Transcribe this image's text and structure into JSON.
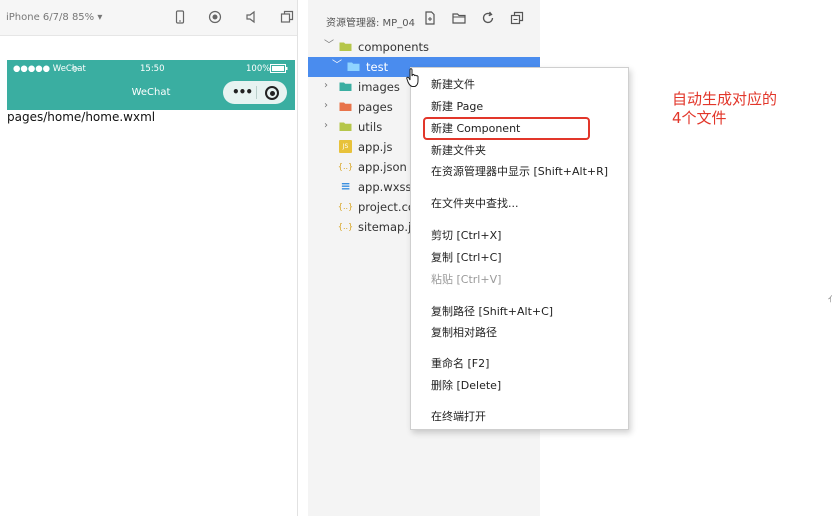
{
  "simulator": {
    "device_label": "iPhone 6/7/8 85% ▾",
    "status": {
      "carrier": "●●●●● WeChat",
      "time": "15:50",
      "battery": "100%"
    },
    "nav_title": "WeChat",
    "page_path": "pages/home/home.wxml"
  },
  "explorer": {
    "title": "资源管理器: MP_04",
    "tree": [
      {
        "label": "components",
        "chevron": "﹀",
        "icon": "folder"
      },
      {
        "label": "test",
        "chevron": "﹀",
        "icon": "folder"
      },
      {
        "label": "images",
        "chevron": "›",
        "icon": "folder"
      },
      {
        "label": "pages",
        "chevron": "›",
        "icon": "folder"
      },
      {
        "label": "utils",
        "chevron": "›",
        "icon": "folder"
      },
      {
        "label": "app.js",
        "glyph": "JS",
        "icon": "js"
      },
      {
        "label": "app.json",
        "glyph": "{..}",
        "icon": "json"
      },
      {
        "label": "app.wxss",
        "glyph": "≡",
        "icon": "wxss"
      },
      {
        "label": "project.co",
        "glyph": "{..}",
        "icon": "json"
      },
      {
        "label": "sitemap.js",
        "glyph": "{..}",
        "icon": "json"
      }
    ]
  },
  "context_menu": {
    "items": [
      {
        "label": "新建文件",
        "disabled": false
      },
      {
        "label": "新建 Page",
        "disabled": false
      },
      {
        "label": "新建 Component",
        "disabled": false
      },
      {
        "label": "新建文件夹",
        "disabled": false
      },
      {
        "label": "在资源管理器中显示  [Shift+Alt+R]",
        "disabled": false
      },
      {
        "label": "在文件夹中查找...",
        "disabled": false
      },
      {
        "label": "剪切  [Ctrl+X]",
        "disabled": false
      },
      {
        "label": "复制  [Ctrl+C]",
        "disabled": false
      },
      {
        "label": "粘贴  [Ctrl+V]",
        "disabled": true
      },
      {
        "label": "复制路径  [Shift+Alt+C]",
        "disabled": false
      },
      {
        "label": "复制相对路径",
        "disabled": false
      },
      {
        "label": "重命名  [F2]",
        "disabled": false
      },
      {
        "label": "删除  [Delete]",
        "disabled": false
      },
      {
        "label": "在终端打开",
        "disabled": false
      }
    ]
  },
  "annotation": {
    "line1": "自动生成对应的",
    "line2": "4个文件"
  },
  "colors": {
    "accent": "#3aaea1",
    "selection": "#4a8cee",
    "highlight": "#e2362a"
  }
}
